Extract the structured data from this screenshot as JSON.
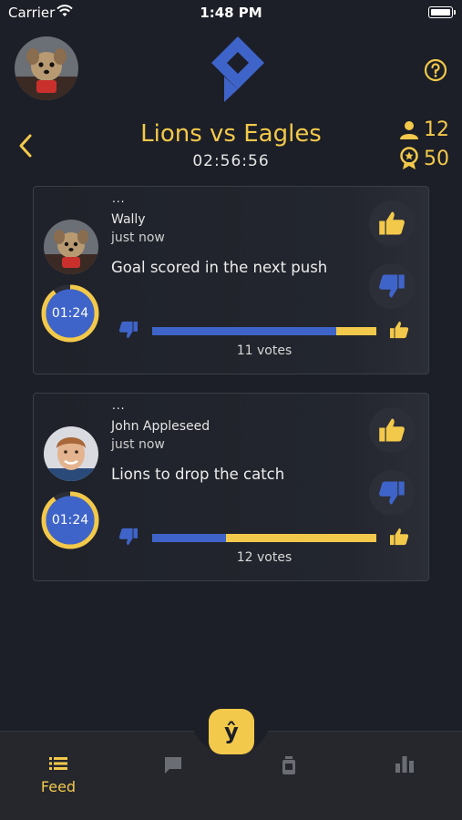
{
  "status_bar": {
    "carrier": "Carrier",
    "time": "1:48 PM"
  },
  "header": {
    "title": "Lions vs Eagles",
    "timer": "02:56:56",
    "players": "12",
    "points": "50"
  },
  "posts": [
    {
      "menu": "...",
      "user": "Wally",
      "time": "just now",
      "text": "Goal scored in the next push",
      "countdown": "01:24",
      "countdown_progress": 0.9,
      "votes_label": "11 votes",
      "down_share": 0.82
    },
    {
      "menu": "...",
      "user": "John Appleseed",
      "time": "just now",
      "text": "Lions to drop the catch",
      "countdown": "01:24",
      "countdown_progress": 0.9,
      "votes_label": "12 votes",
      "down_share": 0.33
    }
  ],
  "fab": {
    "label": "ŷ"
  },
  "nav": {
    "feed_label": "Feed"
  },
  "colors": {
    "accent": "#f3c94b",
    "blue": "#3f64c9",
    "background": "#1c1f27"
  }
}
